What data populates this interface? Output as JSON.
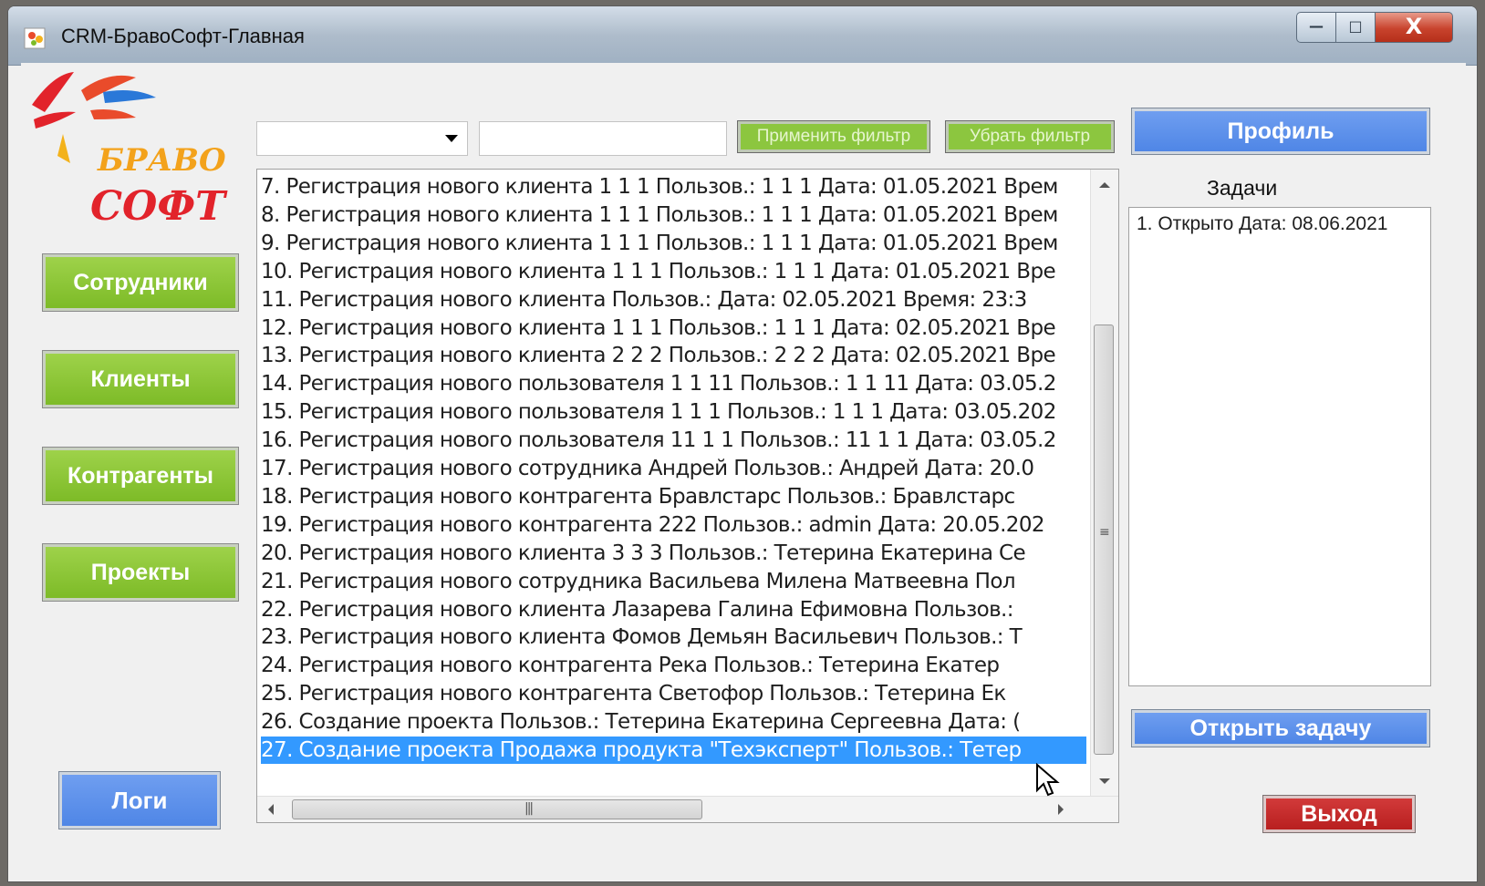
{
  "window": {
    "title": "CRM-БравоСофт-Главная",
    "controls": {
      "minimize": "—",
      "maximize": "□",
      "close": "X"
    }
  },
  "logo": {
    "line1": "БРАВО",
    "line2": "СОФТ"
  },
  "sidebar": {
    "employees": "Сотрудники",
    "clients": "Клиенты",
    "contractors": "Контрагенты",
    "projects": "Проекты",
    "logs": "Логи"
  },
  "filter": {
    "combo_value": "",
    "text_value": "",
    "apply": "Применить фильтр",
    "remove": "Убрать фильтр"
  },
  "logs": {
    "selected_index": 20,
    "rows": [
      "7. Регистрация нового клиента 1 1 1 Пользов.: 1 1 1 Дата: 01.05.2021 Врем",
      "8. Регистрация нового клиента 1 1 1 Пользов.: 1 1 1 Дата: 01.05.2021 Врем",
      "9. Регистрация нового клиента 1 1 1 Пользов.: 1 1 1 Дата: 01.05.2021 Врем",
      "10. Регистрация нового клиента 1 1 1 Пользов.: 1 1 1 Дата: 01.05.2021 Вре",
      "11. Регистрация нового клиента    Пользов.:    Дата: 02.05.2021 Время: 23:3",
      "12. Регистрация нового клиента 1 1 1 Пользов.: 1 1 1 Дата: 02.05.2021 Вре",
      "13. Регистрация нового клиента 2 2 2 Пользов.: 2 2 2 Дата: 02.05.2021 Вре",
      "14. Регистрация нового пользователя 1 1 11 Пользов.: 1 1 11 Дата: 03.05.2",
      "15. Регистрация нового пользователя 1 1 1 Пользов.: 1 1 1 Дата: 03.05.202",
      "16. Регистрация нового пользователя 11 1 1 Пользов.: 11 1 1 Дата: 03.05.2",
      "17. Регистрация нового сотрудника Андрей Пользов.: Андрей Дата: 20.0",
      "18. Регистрация нового контрагента Бравлстарс Пользов.: Бравлстарс",
      "19. Регистрация нового контрагента  222  Пользов.: admin Дата: 20.05.202",
      "20. Регистрация нового клиента 3 3 3 Пользов.: Тетерина Екатерина Се",
      "21. Регистрация нового сотрудника Васильева Милена Матвеевна Пол",
      "22. Регистрация нового клиента Лазарева Галина Ефимовна Пользов.:",
      "23. Регистрация нового клиента Фомов Демьян Васильевич Пользов.: Т",
      "24. Регистрация нового контрагента  Река  Пользов.: Тетерина Екатер",
      "25. Регистрация нового контрагента  Светофор  Пользов.: Тетерина Ек",
      "26. Создание проекта Пользов.: Тетерина Екатерина Сергеевна Дата: (",
      "27. Создание проекта Продажа продукта \"Техэксперт\" Пользов.: Тетер"
    ]
  },
  "right_panel": {
    "profile": "Профиль",
    "tasks_label": "Задачи",
    "tasks": [
      "1. Открыто Дата: 08.06.2021"
    ],
    "open_task": "Открыть задачу",
    "exit": "Выход"
  },
  "colors": {
    "green_button": "#7dbb27",
    "blue_button": "#4f86e6",
    "red_button": "#b81f1f",
    "selection": "#3399ff"
  }
}
